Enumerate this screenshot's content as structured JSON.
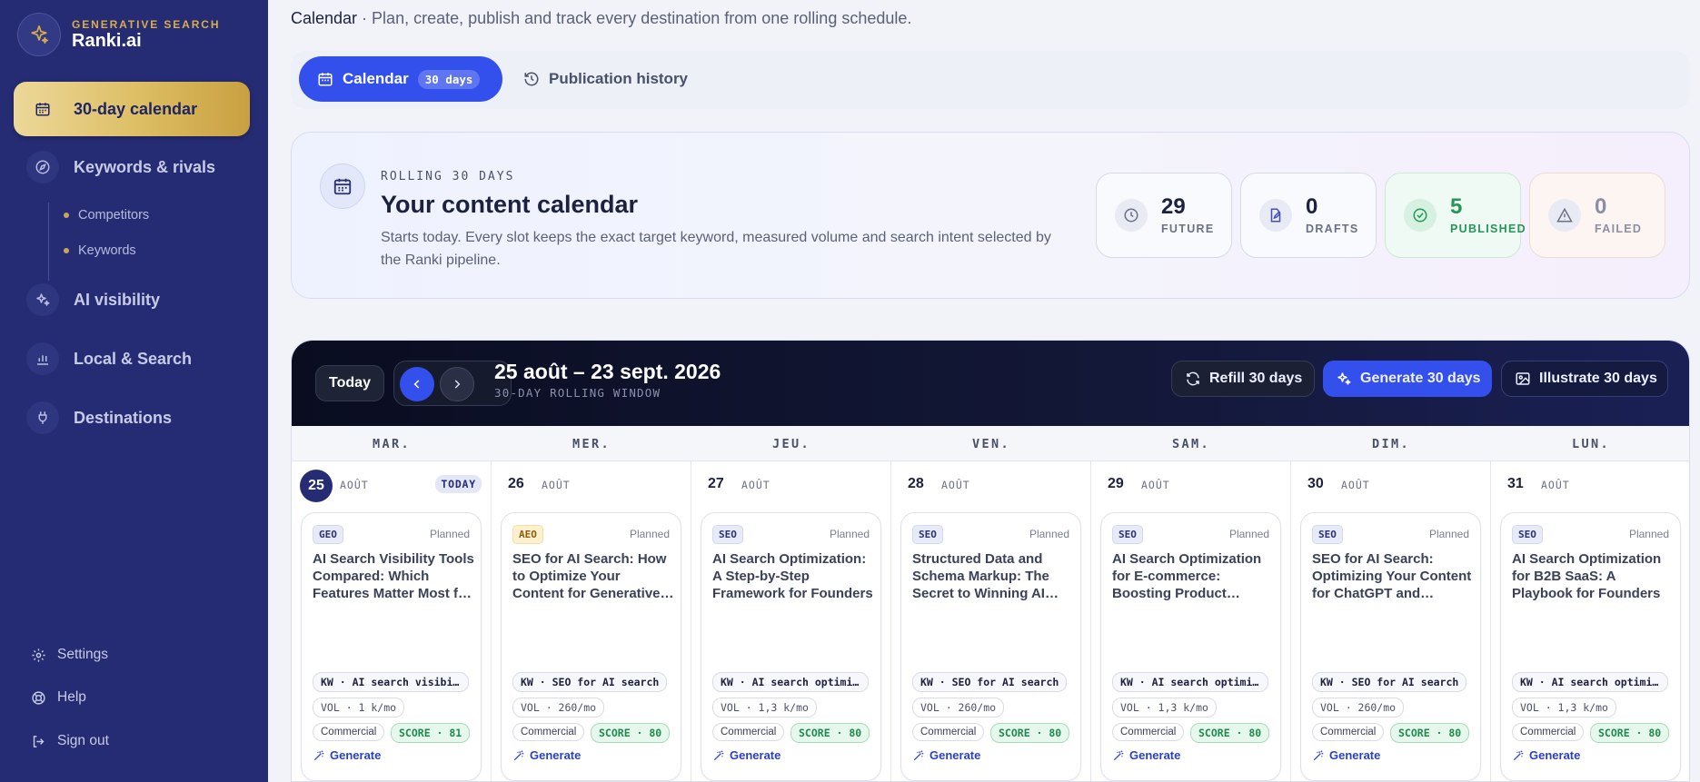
{
  "brand": {
    "subtitle": "GENERATIVE SEARCH",
    "name": "Ranki.ai"
  },
  "sidebar": {
    "items": [
      {
        "label": "30-day calendar",
        "icon": "calendar-icon"
      },
      {
        "label": "Keywords & rivals",
        "icon": "compass-icon"
      },
      {
        "label": "AI visibility",
        "icon": "sparkles-icon"
      },
      {
        "label": "Local & Search",
        "icon": "bar-chart-icon"
      },
      {
        "label": "Destinations",
        "icon": "plug-icon"
      }
    ],
    "subitems": [
      "Competitors",
      "Keywords"
    ],
    "footer": [
      "Settings",
      "Help",
      "Sign out"
    ]
  },
  "header": {
    "title": "Calendar",
    "separator": " · ",
    "subtitle": "Plan, create, publish and track every destination from one rolling schedule."
  },
  "tabs": {
    "calendar": "Calendar",
    "calendar_badge": "30 days",
    "history": "Publication history"
  },
  "hero": {
    "eyebrow": "ROLLING 30 DAYS",
    "title": "Your content calendar",
    "description": "Starts today. Every slot keeps the exact target keyword, measured volume and search intent selected by the Ranki pipeline.",
    "stats": [
      {
        "value": "29",
        "label": "FUTURE"
      },
      {
        "value": "0",
        "label": "DRAFTS"
      },
      {
        "value": "5",
        "label": "PUBLISHED"
      },
      {
        "value": "0",
        "label": "FAILED"
      }
    ]
  },
  "calendar": {
    "today_button": "Today",
    "range": "25 août – 23 sept. 2026",
    "range_sub": "30-DAY ROLLING WINDOW",
    "refill": "Refill 30 days",
    "generate": "Generate 30 days",
    "illustrate": "Illustrate 30 days",
    "today_tag": "TODAY",
    "weekdays": [
      "MAR.",
      "MER.",
      "JEU.",
      "VEN.",
      "SAM.",
      "DIM.",
      "LUN."
    ],
    "days": [
      {
        "num": "25",
        "month": "AOÛT",
        "today": true,
        "tag": "GEO",
        "status": "Planned",
        "title": "AI Search Visibility Tools Compared: Which Features Matter Most for Founders",
        "kw": "KW · AI search visibility tools",
        "vol": "VOL · 1 k/mo",
        "intent": "Commercial",
        "score": "SCORE · 81",
        "action": "Generate"
      },
      {
        "num": "26",
        "month": "AOÛT",
        "today": false,
        "tag": "AEO",
        "status": "Planned",
        "title": "SEO for AI Search: How to Optimize Your Content for Generative Engines",
        "kw": "KW · SEO for AI search",
        "vol": "VOL · 260/mo",
        "intent": "Commercial",
        "score": "SCORE · 80",
        "action": "Generate"
      },
      {
        "num": "27",
        "month": "AOÛT",
        "today": false,
        "tag": "SEO",
        "status": "Planned",
        "title": "AI Search Optimization: A Step-by-Step Framework for Founders",
        "kw": "KW · AI search optimization",
        "vol": "VOL · 1,3 k/mo",
        "intent": "Commercial",
        "score": "SCORE · 80",
        "action": "Generate"
      },
      {
        "num": "28",
        "month": "AOÛT",
        "today": false,
        "tag": "SEO",
        "status": "Planned",
        "title": "Structured Data and Schema Markup: The Secret to Winning AI Search",
        "kw": "KW · SEO for AI search",
        "vol": "VOL · 260/mo",
        "intent": "Commercial",
        "score": "SCORE · 80",
        "action": "Generate"
      },
      {
        "num": "29",
        "month": "AOÛT",
        "today": false,
        "tag": "SEO",
        "status": "Planned",
        "title": "AI Search Optimization for E-commerce: Boosting Product Visibility",
        "kw": "KW · AI search optimization",
        "vol": "VOL · 1,3 k/mo",
        "intent": "Commercial",
        "score": "SCORE · 80",
        "action": "Generate"
      },
      {
        "num": "30",
        "month": "AOÛT",
        "today": false,
        "tag": "SEO",
        "status": "Planned",
        "title": "SEO for AI Search: Optimizing Your Content for ChatGPT and Perplexity",
        "kw": "KW · SEO for AI search",
        "vol": "VOL · 260/mo",
        "intent": "Commercial",
        "score": "SCORE · 80",
        "action": "Generate"
      },
      {
        "num": "31",
        "month": "AOÛT",
        "today": false,
        "tag": "SEO",
        "status": "Planned",
        "title": "AI Search Optimization for B2B SaaS: A Playbook for Founders",
        "kw": "KW · AI search optimization",
        "vol": "VOL · 1,3 k/mo",
        "intent": "Commercial",
        "score": "SCORE · 80",
        "action": "Generate"
      }
    ]
  },
  "colors": {
    "sidebar": "#262c74",
    "accent": "#3450ec",
    "gold": "#d9ad4a",
    "published": "#25965a",
    "score": "#1f8a4f"
  }
}
